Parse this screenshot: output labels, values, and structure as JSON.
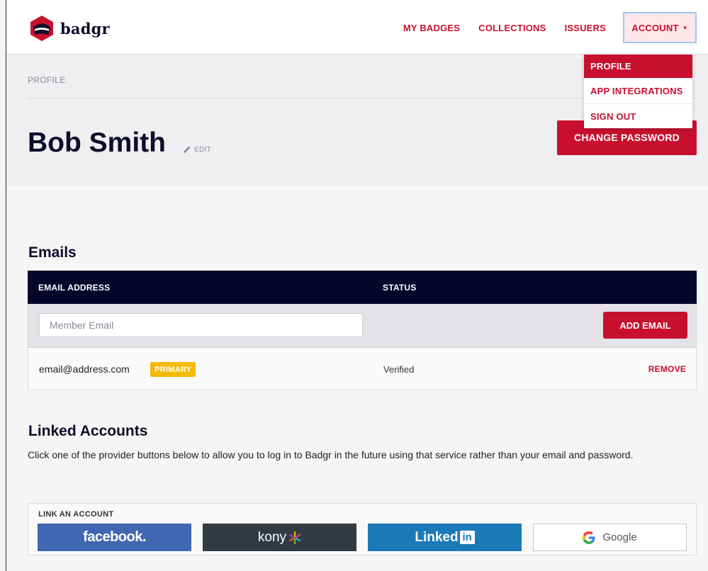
{
  "brand": {
    "name": "badgr"
  },
  "nav": {
    "items": [
      "MY BADGES",
      "COLLECTIONS",
      "ISSUERS"
    ],
    "account_label": "ACCOUNT"
  },
  "account_menu": {
    "items": [
      "PROFILE",
      "APP INTEGRATIONS",
      "SIGN OUT"
    ]
  },
  "profile": {
    "breadcrumb": "PROFILE",
    "name": "Bob Smith",
    "edit_label": "EDIT",
    "change_password_label": "CHANGE PASSWORD"
  },
  "emails": {
    "title": "Emails",
    "columns": [
      "EMAIL ADDRESS",
      "STATUS"
    ],
    "input_placeholder": "Member Email",
    "add_button": "ADD EMAIL",
    "rows": [
      {
        "address": "email@address.com",
        "badge": "PRIMARY",
        "status": "Verified",
        "action": "REMOVE"
      }
    ]
  },
  "linked_accounts": {
    "title": "Linked Accounts",
    "description": "Click one of the provider buttons below to allow you to log in to Badgr in the future using that service rather than your email and password.",
    "box_title": "LINK AN ACCOUNT",
    "providers": {
      "facebook": "facebook.",
      "kony": "kony",
      "linkedin": "Linked",
      "linkedin_box": "in",
      "google": "Google"
    }
  },
  "colors": {
    "accent": "#c8102e",
    "navy": "#06062b",
    "badge_yellow": "#f5b90a",
    "facebook": "#4267b2",
    "kony": "#323b42",
    "linkedin": "#1a7ab9"
  }
}
